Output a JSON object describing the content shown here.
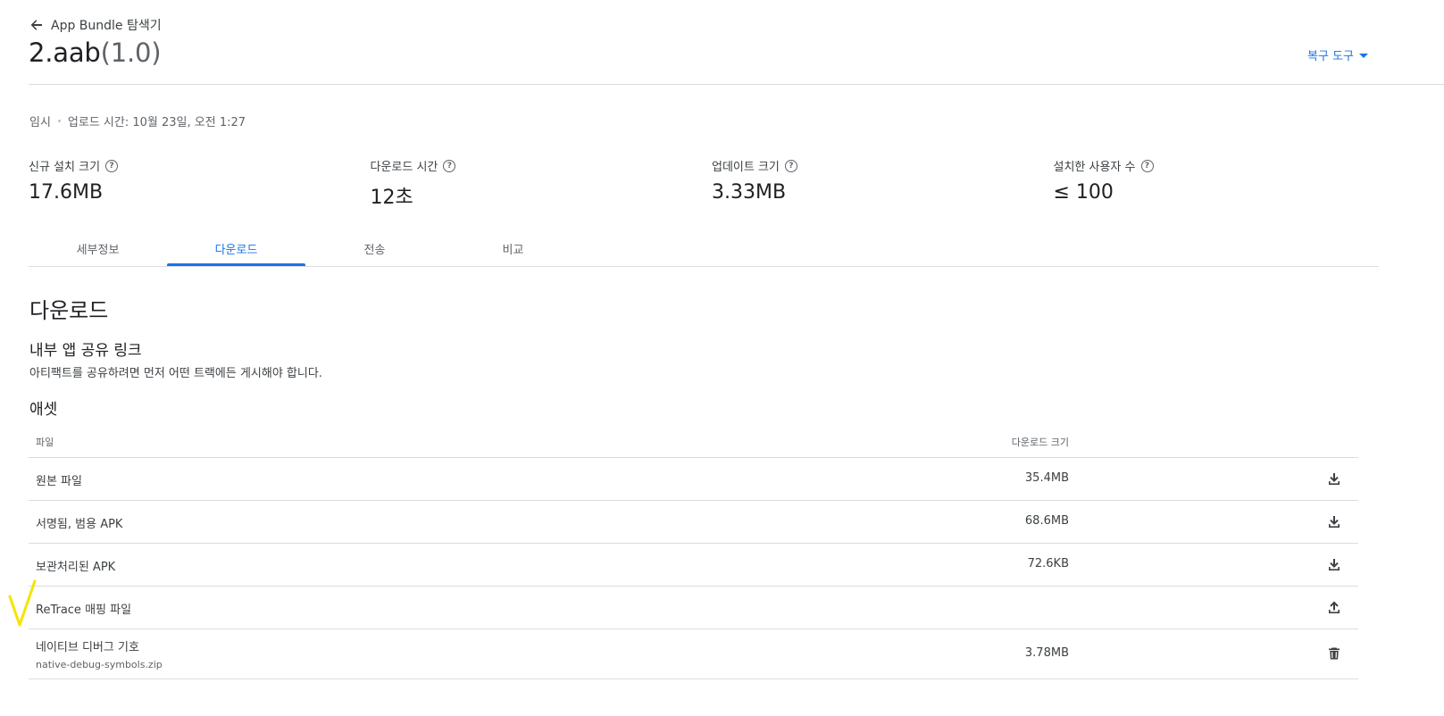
{
  "header": {
    "back_label": "App Bundle 탐색기",
    "title_name": "2.aab",
    "title_version": "(1.0)",
    "recovery_label": "복구 도구"
  },
  "meta": {
    "status": "임시",
    "upload_time": "업로드 시간: 10월 23일, 오전 1:27"
  },
  "stats": [
    {
      "label": "신규 설치 크기",
      "value": "17.6MB"
    },
    {
      "label": "다운로드 시간",
      "value": "12초"
    },
    {
      "label": "업데이트 크기",
      "value": "3.33MB"
    },
    {
      "label": "설치한 사용자 수",
      "value": "≤ 100"
    }
  ],
  "tabs": [
    {
      "label": "세부정보",
      "active": false
    },
    {
      "label": "다운로드",
      "active": true
    },
    {
      "label": "전송",
      "active": false
    },
    {
      "label": "비교",
      "active": false
    }
  ],
  "downloads": {
    "heading": "다운로드",
    "share_heading": "내부 앱 공유 링크",
    "share_desc": "아티팩트를 공유하려면 먼저 어떤 트랙에든 게시해야 합니다.",
    "assets_heading": "애셋",
    "columns": {
      "file": "파일",
      "size": "다운로드 크기"
    },
    "rows": [
      {
        "name": "원본 파일",
        "sub": "",
        "size": "35.4MB",
        "action": "download-icon"
      },
      {
        "name": "서명됨, 범용 APK",
        "sub": "",
        "size": "68.6MB",
        "action": "download-icon"
      },
      {
        "name": "보관처리된 APK",
        "sub": "",
        "size": "72.6KB",
        "action": "download-icon"
      },
      {
        "name": "ReTrace 매핑 파일",
        "sub": "",
        "size": "",
        "action": "upload-icon"
      },
      {
        "name": "네이티브 디버그 기호",
        "sub": "native-debug-symbols.zip",
        "size": "3.78MB",
        "action": "delete-icon"
      }
    ]
  },
  "colors": {
    "accent": "#1a73e8",
    "annotation": "#f5e400"
  }
}
